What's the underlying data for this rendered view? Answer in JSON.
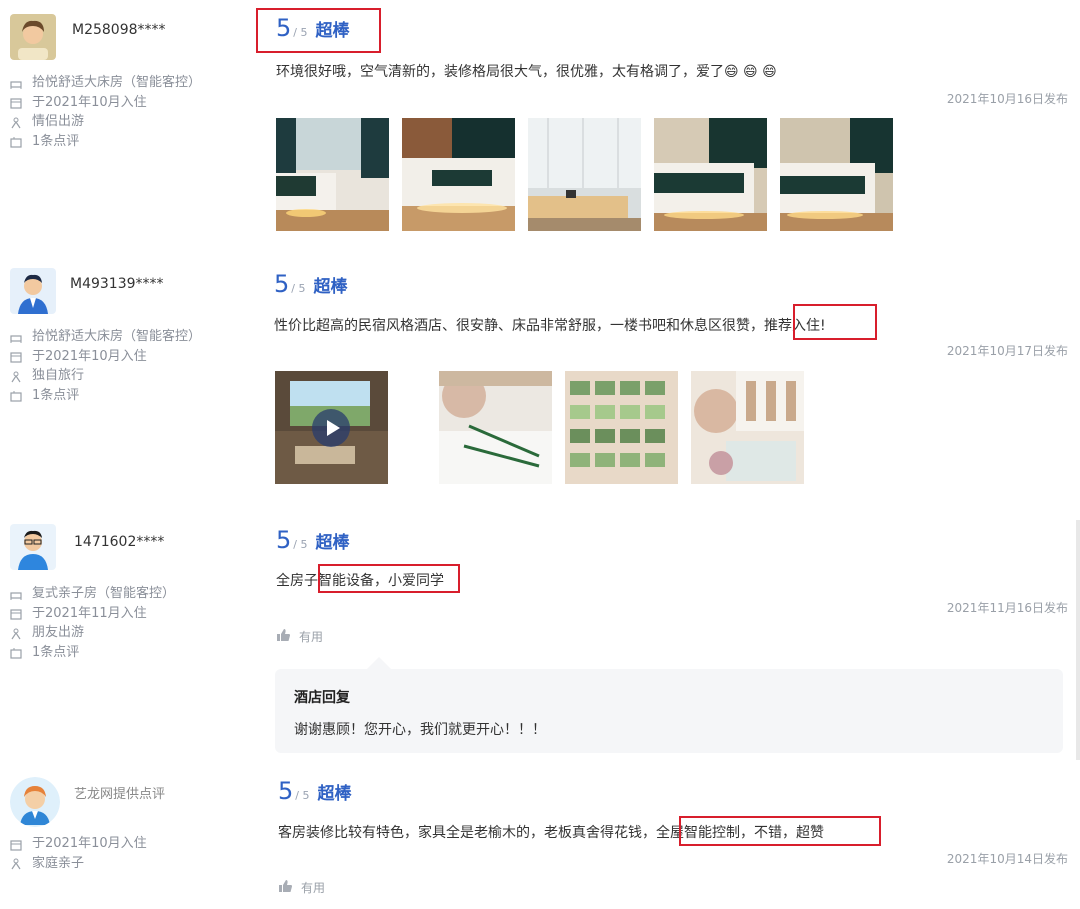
{
  "reviews": [
    {
      "username": "M258098****",
      "room": "拾悦舒适大床房（智能客控）",
      "checkin": "于2021年10月入住",
      "trip": "情侣出游",
      "count": "1条点评",
      "score": "5",
      "score_den": "/ 5",
      "rating": "超棒",
      "text": "环境很好哦，空气清新的，装修格局很大气，很优雅，太有格调了，爱了😄 😄 😄",
      "date": "2021年10月16日发布"
    },
    {
      "username": "M493139****",
      "room": "拾悦舒适大床房（智能客控）",
      "checkin": "于2021年10月入住",
      "trip": "独自旅行",
      "count": "1条点评",
      "score": "5",
      "score_den": "/ 5",
      "rating": "超棒",
      "text_before": "性价比超高的民宿风格酒店、很安静、床品非常舒服，一楼书吧和休息区很赞，",
      "text_highlight": "推荐入住!",
      "date": "2021年10月17日发布"
    },
    {
      "username": "1471602****",
      "room": "复式亲子房（智能客控）",
      "checkin": "于2021年11月入住",
      "trip": "朋友出游",
      "count": "1条点评",
      "score": "5",
      "score_den": "/ 5",
      "rating": "超棒",
      "text_before": "全房子",
      "text_highlight": "智能设备，小爱同学",
      "date": "2021年11月16日发布",
      "useful": "有用",
      "reply_title": "酒店回复",
      "reply_text": "谢谢惠顾！您开心，我们就更开心！！！"
    },
    {
      "username": "艺龙网提供点评",
      "checkin": "于2021年10月入住",
      "trip": "家庭亲子",
      "score": "5",
      "score_den": "/ 5",
      "rating": "超棒",
      "text_before": "客房装修比较有特色，家具全是老榆木的，老板真舍得花钱，",
      "text_highlight": "全屋智能控制，不错，超赞",
      "date": "2021年10月14日发布",
      "useful": "有用"
    }
  ],
  "colors": {
    "accent": "#2f61c4",
    "highlight_box": "#d81e2c",
    "muted": "#8a8f99"
  }
}
